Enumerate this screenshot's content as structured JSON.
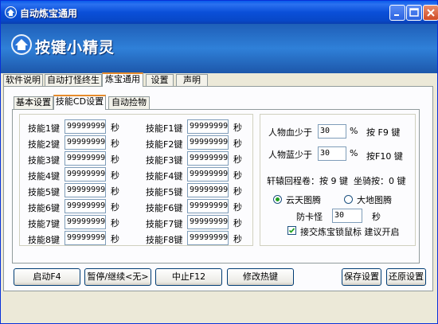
{
  "window": {
    "title": "自动炼宝通用"
  },
  "banner": {
    "logo_text": "按键小精灵"
  },
  "tabs": [
    {
      "label": "软件说明"
    },
    {
      "label": "自动打怪终生"
    },
    {
      "label": "炼宝通用"
    },
    {
      "label": "设置"
    },
    {
      "label": "声明"
    }
  ],
  "subtabs": [
    {
      "label": "基本设置"
    },
    {
      "label": "技能CD设置"
    },
    {
      "label": "自动捡物"
    }
  ],
  "skills_left": [
    {
      "label": "技能1键",
      "value": "99999999",
      "unit": "秒"
    },
    {
      "label": "技能2键",
      "value": "99999999",
      "unit": "秒"
    },
    {
      "label": "技能3键",
      "value": "99999999",
      "unit": "秒"
    },
    {
      "label": "技能4键",
      "value": "99999999",
      "unit": "秒"
    },
    {
      "label": "技能5键",
      "value": "99999999",
      "unit": "秒"
    },
    {
      "label": "技能6键",
      "value": "99999999",
      "unit": "秒"
    },
    {
      "label": "技能7键",
      "value": "99999999",
      "unit": "秒"
    },
    {
      "label": "技能8键",
      "value": "99999999",
      "unit": "秒"
    }
  ],
  "skills_right": [
    {
      "label": "技能F1键",
      "value": "99999999",
      "unit": "秒"
    },
    {
      "label": "技能F2键",
      "value": "99999999",
      "unit": "秒"
    },
    {
      "label": "技能F3键",
      "value": "99999999",
      "unit": "秒"
    },
    {
      "label": "技能F4键",
      "value": "99999999",
      "unit": "秒"
    },
    {
      "label": "技能F5键",
      "value": "99999999",
      "unit": "秒"
    },
    {
      "label": "技能F6键",
      "value": "99999999",
      "unit": "秒"
    },
    {
      "label": "技能F7键",
      "value": "99999999",
      "unit": "秒"
    },
    {
      "label": "技能F8键",
      "value": "99999999",
      "unit": "秒"
    }
  ],
  "right_panel": {
    "hp_label": "人物血少于",
    "hp_value": "30",
    "hp_unit": "%",
    "hp_key": "按 F9 键",
    "mp_label": "人物蓝少于",
    "mp_value": "30",
    "mp_unit": "%",
    "mp_key": "按F10 键",
    "scroll_text": "轩辕回程卷：按 9 键",
    "mount_text": "坐骑按：0 键",
    "radio_1": "云天图腾",
    "radio_2": "大地图腾",
    "anti_stuck_label": "防卡怪",
    "anti_stuck_value": "30",
    "anti_stuck_unit": "秒",
    "checkbox_label": "接交炼宝锁鼠标 建议开启"
  },
  "buttons": {
    "start": "启动F4",
    "pause": "暂停/继续<无>",
    "stop": "中止F12",
    "hotkey": "修改热键",
    "save": "保存设置",
    "restore": "还原设置"
  }
}
